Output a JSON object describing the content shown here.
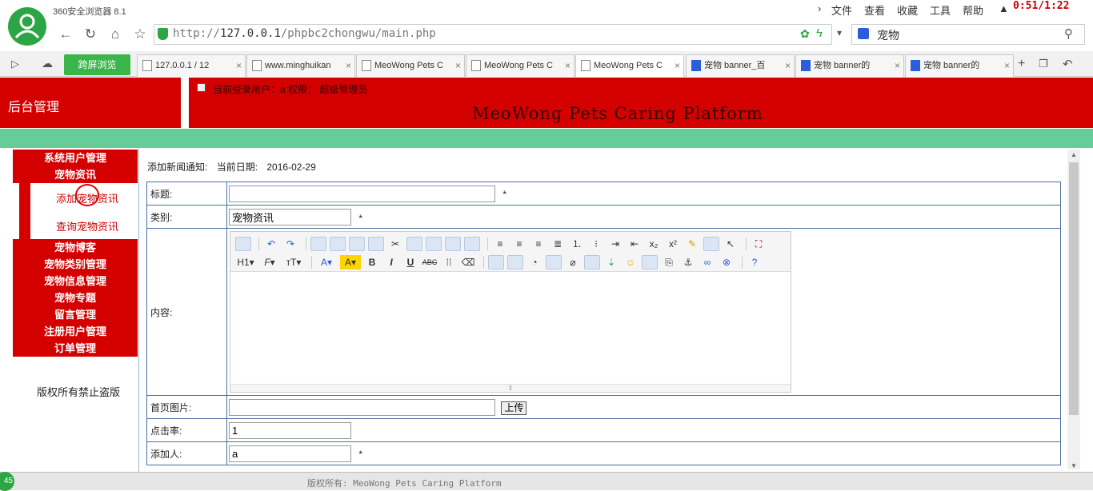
{
  "browser": {
    "app_title": "360安全浏览器 8.1",
    "menu": [
      "文件",
      "查看",
      "收藏",
      "工具",
      "帮助"
    ],
    "clock": "0:51/1:22",
    "url_prefix": "http://",
    "url_host": "127.0.0.1",
    "url_path": "/phpbc2chongwu/main.php",
    "search_value": "宠物",
    "green_tab": "跨屏浏览",
    "tabs": [
      {
        "label": "127.0.0.1 / 12",
        "icon": "phpmyadmin-icon"
      },
      {
        "label": "www.minghuikan",
        "icon": "cart-icon"
      },
      {
        "label": "MeoWong Pets C",
        "icon": "page-icon"
      },
      {
        "label": "MeoWong Pets C",
        "icon": "page-icon"
      },
      {
        "label": "MeoWong Pets C",
        "icon": "page-icon"
      },
      {
        "label": "宠物 banner_百",
        "icon": "paw-icon"
      },
      {
        "label": "宠物 banner的",
        "icon": "paw-icon"
      },
      {
        "label": "宠物 banner的",
        "icon": "paw-icon"
      }
    ]
  },
  "header": {
    "logo_text": "后台管理",
    "user_info": "当前登录用户：a 权限： 超级管理员",
    "platform_title": "MeoWong Pets Caring Platform"
  },
  "sidebar": {
    "items_top": [
      "系统用户管理",
      "宠物资讯"
    ],
    "sub_items": [
      "添加宠物资讯",
      "查询宠物资讯"
    ],
    "items_bottom": [
      "宠物博客",
      "宠物类别管理",
      "宠物信息管理",
      "宠物专题",
      "留言管理",
      "注册用户管理",
      "订单管理"
    ],
    "copyright": "版权所有禁止盗版"
  },
  "form": {
    "heading": "添加新闻通知:",
    "date_label": "当前日期:",
    "date_value": "2016-02-29",
    "title_label": "标题:",
    "title_value": "",
    "category_label": "类别:",
    "category_value": "宠物资讯",
    "content_label": "内容:",
    "image_label": "首页图片:",
    "image_value": "",
    "upload_label": "上传",
    "clicks_label": "点击率:",
    "clicks_value": "1",
    "author_label": "添加人:",
    "author_value": "a",
    "required_mark": "*"
  },
  "status": {
    "text": "版权所有: MeoWong Pets Caring Platform",
    "badge": "45"
  },
  "colors": {
    "brand_red": "#d40000",
    "green_bar": "#66cc99",
    "browser_green": "#2ca544"
  }
}
